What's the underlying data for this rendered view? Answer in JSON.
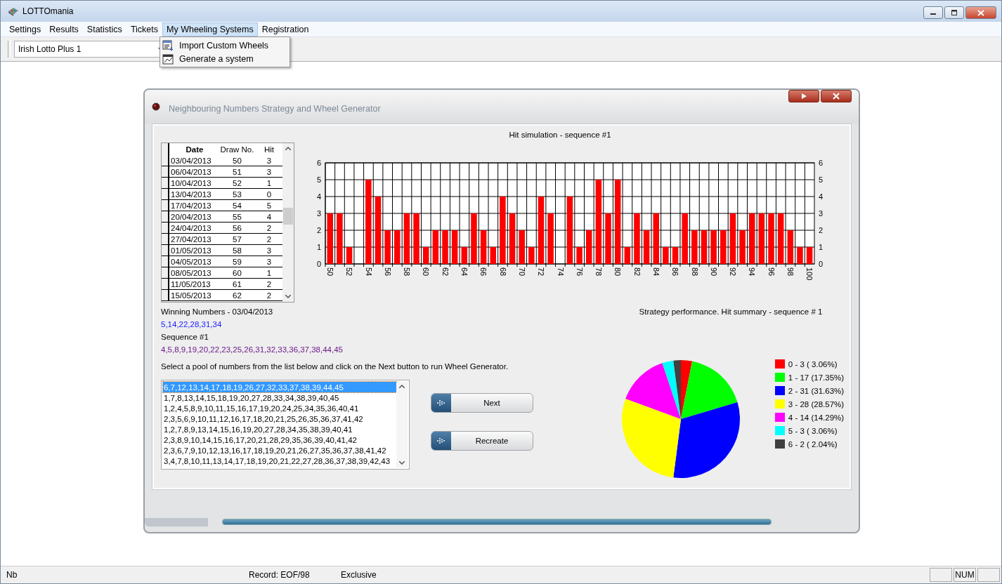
{
  "window": {
    "title": "LOTTOmania"
  },
  "menu": [
    {
      "label": "Settings",
      "selected": false
    },
    {
      "label": "Results",
      "selected": false
    },
    {
      "label": "Statistics",
      "selected": false
    },
    {
      "label": "Tickets",
      "selected": false
    },
    {
      "label": "My Wheeling Systems",
      "selected": true
    },
    {
      "label": "Registration",
      "selected": false
    }
  ],
  "open_menu": [
    "Import Custom Wheels",
    "Generate a system"
  ],
  "toolbar": {
    "lottery": "Irish Lotto Plus 1"
  },
  "dialog": {
    "title": "Neighbouring Numbers Strategy and Wheel Generator",
    "draws_table": {
      "columns": [
        "Date",
        "Draw No.",
        "Hit"
      ],
      "rows": [
        [
          "03/04/2013",
          "50",
          "3"
        ],
        [
          "06/04/2013",
          "51",
          "3"
        ],
        [
          "10/04/2013",
          "52",
          "1"
        ],
        [
          "13/04/2013",
          "53",
          "0"
        ],
        [
          "17/04/2013",
          "54",
          "5"
        ],
        [
          "20/04/2013",
          "55",
          "4"
        ],
        [
          "24/04/2013",
          "56",
          "2"
        ],
        [
          "27/04/2013",
          "57",
          "2"
        ],
        [
          "01/05/2013",
          "58",
          "3"
        ],
        [
          "04/05/2013",
          "59",
          "3"
        ],
        [
          "08/05/2013",
          "60",
          "1"
        ],
        [
          "11/05/2013",
          "61",
          "2"
        ],
        [
          "15/05/2013",
          "62",
          "2"
        ]
      ]
    },
    "hit_chart": {
      "chart_data": {
        "type": "bar",
        "title": "Hit simulation - sequence #1",
        "x": [
          50,
          51,
          52,
          53,
          54,
          55,
          56,
          57,
          58,
          59,
          60,
          61,
          62,
          63,
          64,
          65,
          66,
          67,
          68,
          69,
          70,
          71,
          72,
          73,
          74,
          75,
          76,
          77,
          78,
          79,
          80,
          81,
          82,
          83,
          84,
          85,
          86,
          87,
          88,
          89,
          90,
          91,
          92,
          93,
          94,
          95,
          96,
          97,
          98,
          99,
          100
        ],
        "xticks": [
          50,
          52,
          54,
          56,
          58,
          60,
          62,
          64,
          66,
          68,
          70,
          72,
          74,
          76,
          78,
          80,
          82,
          84,
          86,
          88,
          90,
          92,
          94,
          96,
          98,
          100
        ],
        "grid": true,
        "series": [
          {
            "color": "#ff0000",
            "values": [
              3,
              3,
              1,
              0,
              5,
              4,
              2,
              2,
              3,
              3,
              1,
              2,
              2,
              2,
              1,
              3,
              2,
              1,
              4,
              3,
              2,
              1,
              4,
              3,
              0,
              4,
              1,
              2,
              5,
              3,
              5,
              1,
              3,
              2,
              3,
              1,
              1,
              3,
              2,
              2,
              2,
              2,
              3,
              2,
              3,
              3,
              3,
              3,
              2,
              1,
              1
            ]
          }
        ],
        "xlim": [
          49.5,
          100.5
        ],
        "ylim": [
          0,
          6
        ],
        "yticks": [
          0,
          1,
          2,
          3,
          4,
          5,
          6
        ],
        "y2ticks": [
          0,
          1,
          2,
          3,
          4,
          5,
          6
        ],
        "y2lim": [
          0,
          6
        ]
      }
    },
    "winning_label": "Winning Numbers - 03/04/2013",
    "winning_numbers": "5,14,22,28,31,34",
    "sequence_label": "Sequence #1",
    "sequence_numbers": "4,5,8,9,19,20,22,23,25,26,31,32,33,36,37,38,44,45",
    "instruction": "Select a pool of numbers from the list below and click on the Next button to run Wheel Generator.",
    "pools": [
      {
        "numbers": "6,7,12,13,14,17,18,19,26,27,32,33,37,38,39,44,45",
        "selected": true
      },
      {
        "numbers": "1,7,8,13,14,15,18,19,20,27,28,33,34,38,39,40,45",
        "selected": false
      },
      {
        "numbers": "1,2,4,5,8,9,10,11,15,16,17,19,20,24,25,34,35,36,40,41",
        "selected": false
      },
      {
        "numbers": "2,3,5,6,9,10,11,12,16,17,18,20,21,25,26,35,36,37,41,42",
        "selected": false
      },
      {
        "numbers": "1,2,7,8,9,13,14,15,16,19,20,27,28,34,35,38,39,40,41",
        "selected": false
      },
      {
        "numbers": "2,3,8,9,10,14,15,16,17,20,21,28,29,35,36,39,40,41,42",
        "selected": false
      },
      {
        "numbers": "2,3,6,7,9,10,12,13,16,17,18,19,20,21,26,27,35,36,37,38,41,42",
        "selected": false
      },
      {
        "numbers": "3,4,7,8,10,11,13,14,17,18,19,20,21,22,27,28,36,37,38,39,42,43",
        "selected": false
      }
    ],
    "buttons": [
      "Next",
      "Recreate"
    ],
    "summary_chart": {
      "chart_data": {
        "type": "pie",
        "title": "Strategy performance. Hit summary - sequence # 1",
        "values": [
          3,
          17,
          31,
          28,
          14,
          3,
          2
        ]
      },
      "legend": [
        {
          "label": "0 - 3 ( 3.06%)",
          "color": "#ff0000"
        },
        {
          "label": "1 - 17 (17.35%)",
          "color": "#00ff00"
        },
        {
          "label": "2 - 31 (31.63%)",
          "color": "#0000ff"
        },
        {
          "label": "3 - 28 (28.57%)",
          "color": "#ffff00"
        },
        {
          "label": "4 - 14 (14.29%)",
          "color": "#ff00ff"
        },
        {
          "label": "5 - 3 ( 3.06%)",
          "color": "#00ffff"
        },
        {
          "label": "6 - 2 ( 2.04%)",
          "color": "#404040"
        }
      ]
    }
  },
  "status_bar": {
    "field": "Nb",
    "record": "Record: EOF/98",
    "mode": "Exclusive",
    "indicators": [
      {
        "label": "NUM"
      }
    ]
  }
}
